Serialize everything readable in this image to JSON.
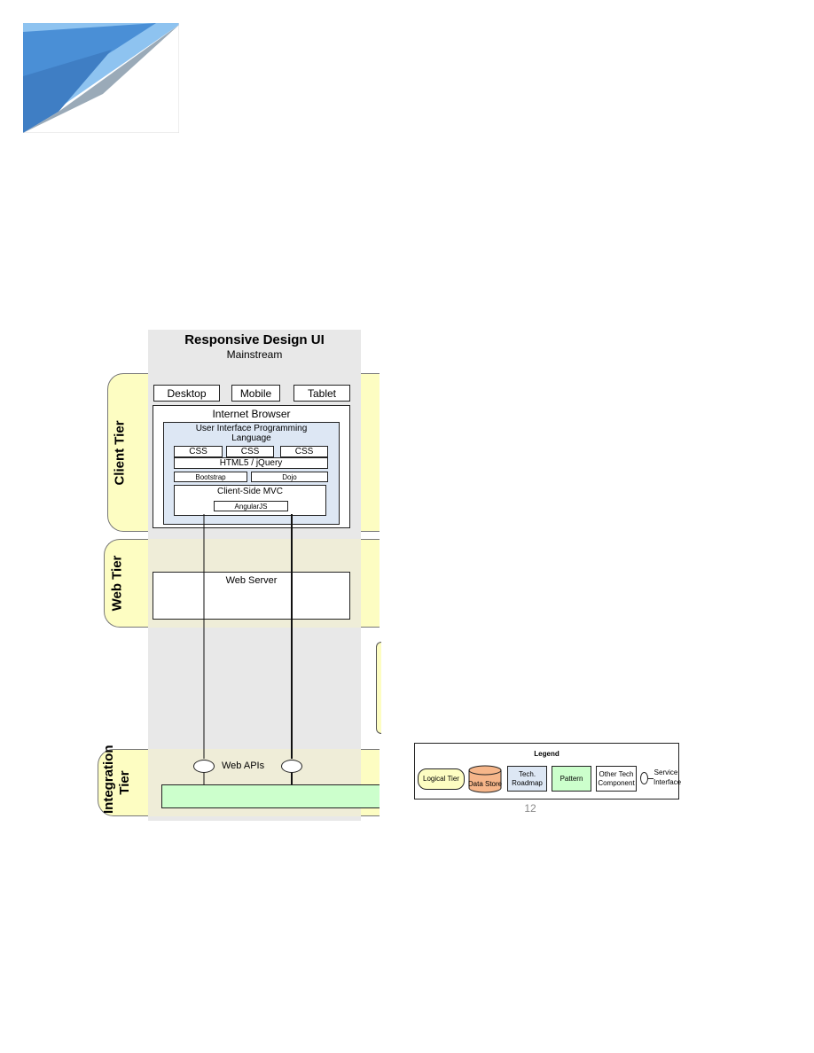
{
  "header": {
    "logo_icon": "corner-ribbon-logo"
  },
  "diagram": {
    "title": "Responsive Design UI",
    "subtitle": "Mainstream",
    "tiers": {
      "client": "Client Tier",
      "web": "Web Tier",
      "integration": "Integration Tier"
    },
    "devices": [
      "Desktop",
      "Mobile",
      "Tablet"
    ],
    "browser": "Internet Browser",
    "ui_lang": "User Interface Programming Language",
    "css": [
      "CSS",
      "CSS",
      "CSS"
    ],
    "html5": "HTML5 / jQuery",
    "frameworks": [
      "Bootstrap",
      "Dojo"
    ],
    "mvc": "Client-Side MVC",
    "angular": "AngularJS",
    "web_server": "Web Server",
    "web_apis": "Web APIs"
  },
  "legend": {
    "title": "Legend",
    "items": [
      "Logical Tier",
      "Data Store",
      "Tech. Roadmap",
      "Pattern",
      "Other Tech Component",
      "Service Interface"
    ]
  },
  "page_number": "12",
  "colors": {
    "logo_blue": "#4a8fd6",
    "logo_light": "#8ec3f0",
    "logo_grey": "#9aaab8",
    "column_grey": "#e8e8e8",
    "tier_yellow": "#fdfdc2",
    "tier_beige": "#efedd8",
    "ui_lang_blue": "#dde7f4",
    "pattern_green": "#ccffcc",
    "data_store_orange": "#f6b68a"
  }
}
